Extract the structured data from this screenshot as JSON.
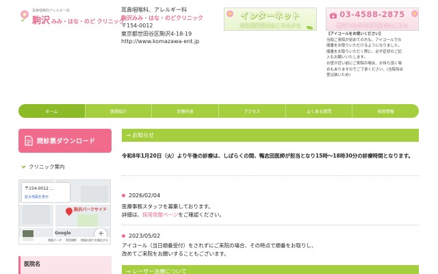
{
  "header": {
    "logo": {
      "subtitle": "耳鼻咽喉科アレルギー科",
      "brand": "駒沢",
      "name": "みみ・はな・のど クリニック"
    },
    "clinic": {
      "dept": "耳鼻咽喉科、アレルギー科",
      "name": "駒沢みみ・はな・のどクリニック",
      "zip": "〒154-0012",
      "address": "東京都世田谷区駒沢4-18-19",
      "url": "http://www.komazawa-ent.jp"
    },
    "banner_net": {
      "line1": "インターネット",
      "line2": "当日順番受付はこちらから"
    },
    "banner_tel": {
      "line1": "03-4588-2875",
      "line2": "電話での当日順番受付はこちら"
    },
    "notice": {
      "title": "【アイコールをお使いください】",
      "lines": [
        "当院ご来院が初めての方も、アイコールでの",
        "順番をお取りいただけるようになりました。",
        "順番をお取りいただく際に、必ず症状のご記",
        "入もお願いいたします。",
        "お昼が近い前にご来院の場合、お待ち頂く場",
        "合もありますのでご了承ください。(当院待合",
        "室は狭いため)"
      ]
    }
  },
  "nav": [
    "ホーム",
    "医師紹介",
    "診療内容",
    "アクセス",
    "よくある質問",
    "採用情報"
  ],
  "sidebar": {
    "download_label": "問診票ダウンロード",
    "guide_label": "クリニック案内",
    "map": {
      "address": "〒154-0012 ...",
      "enlarge": "拡大地図を表示",
      "place": "駒沢パークサイド",
      "brand": "Google",
      "footer": [
        "地図データ",
        "利用規約",
        "地図の誤りを報告する"
      ]
    },
    "section_label": "医院名"
  },
  "main": {
    "news_title": "→ お知らせ",
    "headline": "令和8年1月20日（火）より午後の診療は、しばらくの間、鴨志田医師が担当となり15時～18時30分の診療時間となります。",
    "items": [
      {
        "date": "2026/02/04",
        "line1": "医療事務スタッフを募集しております。",
        "line2_pre": "詳細は、",
        "line2_link": "採用情報ページ",
        "line2_post": "をご確認ください。"
      },
      {
        "date": "2023/05/02",
        "line1": "アイコール（当日順番受付）をされずにご来院の場合、その時点で順番をお取りし、",
        "line2": "改めてご来院をお願いすることもございます。"
      }
    ],
    "laser_title": "→ レーザー治療について"
  },
  "colors": {
    "green": "#a5cf3e",
    "pink": "#f16b8d",
    "logo_pink": "#e56c8e"
  }
}
